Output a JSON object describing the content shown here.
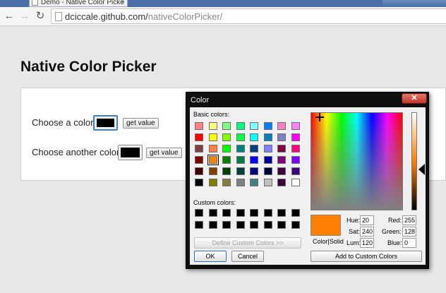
{
  "browser": {
    "tab_title": "Demo - Native Color Picke",
    "tab_close": "×",
    "url_domain": "dciccale.github.com/",
    "url_path": "nativeColorPicker/"
  },
  "page": {
    "title": "Native Color Picker",
    "row1_label": "Choose a color:",
    "row2_label": "Choose another color:",
    "get_value_1": "get value",
    "get_value_2": "get value"
  },
  "dialog": {
    "title": "Color",
    "close": "✕",
    "basic_label": "Basic colors:",
    "custom_label": "Custom colors:",
    "define_custom": "Define Custom Colors >>",
    "ok": "OK",
    "cancel": "Cancel",
    "add_custom": "Add to Custom Colors",
    "color_solid": "Color|Solid",
    "hue_label": "Hue:",
    "hue": "20",
    "sat_label": "Sat:",
    "sat": "240",
    "lum_label": "Lum:",
    "lum": "120",
    "red_label": "Red:",
    "red": "255",
    "green_label": "Green:",
    "green": "128",
    "blue_label": "Blue:",
    "blue": "0",
    "basic_colors": [
      [
        "#ff8080",
        "#ffff80",
        "#80ff80",
        "#00ff80",
        "#80ffff",
        "#0080ff",
        "#ff80c0",
        "#ff80ff"
      ],
      [
        "#ff0000",
        "#ffff00",
        "#80ff00",
        "#00ff40",
        "#00ffff",
        "#0080c0",
        "#8080c0",
        "#ff00ff"
      ],
      [
        "#804040",
        "#ff8040",
        "#00ff00",
        "#008080",
        "#004080",
        "#8080ff",
        "#800040",
        "#ff0080"
      ],
      [
        "#800000",
        "#ff8000",
        "#008000",
        "#008040",
        "#0000ff",
        "#0000a0",
        "#800080",
        "#8000ff"
      ],
      [
        "#400000",
        "#804000",
        "#004000",
        "#004040",
        "#000080",
        "#000040",
        "#400040",
        "#400080"
      ],
      [
        "#000000",
        "#808000",
        "#808040",
        "#808080",
        "#408080",
        "#c0c0c0",
        "#400040",
        "#ffffff"
      ]
    ],
    "selected_basic": [
      3,
      1
    ],
    "current_color": "#ff8000"
  }
}
